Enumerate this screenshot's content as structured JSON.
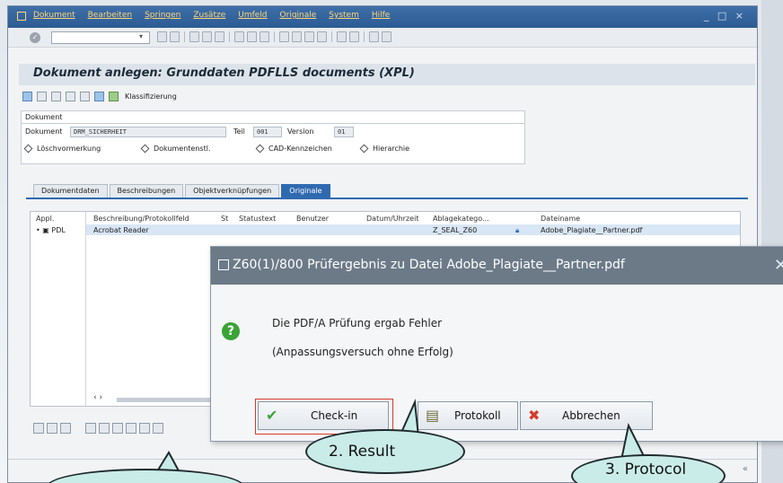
{
  "menu": {
    "items": [
      "Dokument",
      "Bearbeiten",
      "Springen",
      "Zusätze",
      "Umfeld",
      "Originale",
      "System",
      "Hilfe"
    ],
    "window_controls": "_ □ ×"
  },
  "screen": {
    "title": "Dokument anlegen: Grunddaten  PDFLLS documents (XPL)",
    "toolbar_label": "Klassifizierung"
  },
  "doc_group": {
    "title": "Dokument",
    "dokument_label": "Dokument",
    "dokument_value": "DRM_SICHERHEIT",
    "teil_label": "Teil",
    "teil_value": "001",
    "version_label": "Version",
    "version_value": "01",
    "checks": [
      "Löschvormerkung",
      "Dokumentenstl.",
      "CAD-Kennzeichen",
      "Hierarchie"
    ]
  },
  "tabs": [
    "Dokumentdaten",
    "Beschreibungen",
    "Objektverknüpfungen",
    "Originale"
  ],
  "list": {
    "columns": [
      "Appl.",
      "Beschreibung/Protokollfeld",
      "St",
      "Statustext",
      "Benutzer",
      "Datum/Uhrzeit",
      "Ablagekatego...",
      "Dateiname"
    ],
    "row": {
      "appl": "PDL",
      "beschreibung": "Acrobat Reader",
      "ablage": "Z_SEAL_Z60",
      "dateiname": "Adobe_Plagiate__Partner.pdf"
    },
    "scroll_arrows": "‹ ›"
  },
  "dialog": {
    "title": "Z60(1)/800 Prüfergebnis zu Datei Adobe_Plagiate__Partner.pdf",
    "message_line1": "Die PDF/A Prüfung ergab Fehler",
    "message_line2": "(Anpassungsversuch ohne Erfolg)",
    "btn_checkin": "Check-in",
    "btn_protokoll": "Protokoll",
    "btn_abbrechen": "Abbrechen"
  },
  "callouts": {
    "result": "2. Result",
    "protocol": "3. Protocol"
  },
  "colors": {
    "menubar": "#2c5b93",
    "menu_text": "#ffd77a",
    "active_tab": "#2f6ab0",
    "dialog_title": "#6c7a88",
    "callout_fill": "#c9ece8",
    "ok_green": "#3aa336",
    "cancel_red": "#d63b2c"
  }
}
